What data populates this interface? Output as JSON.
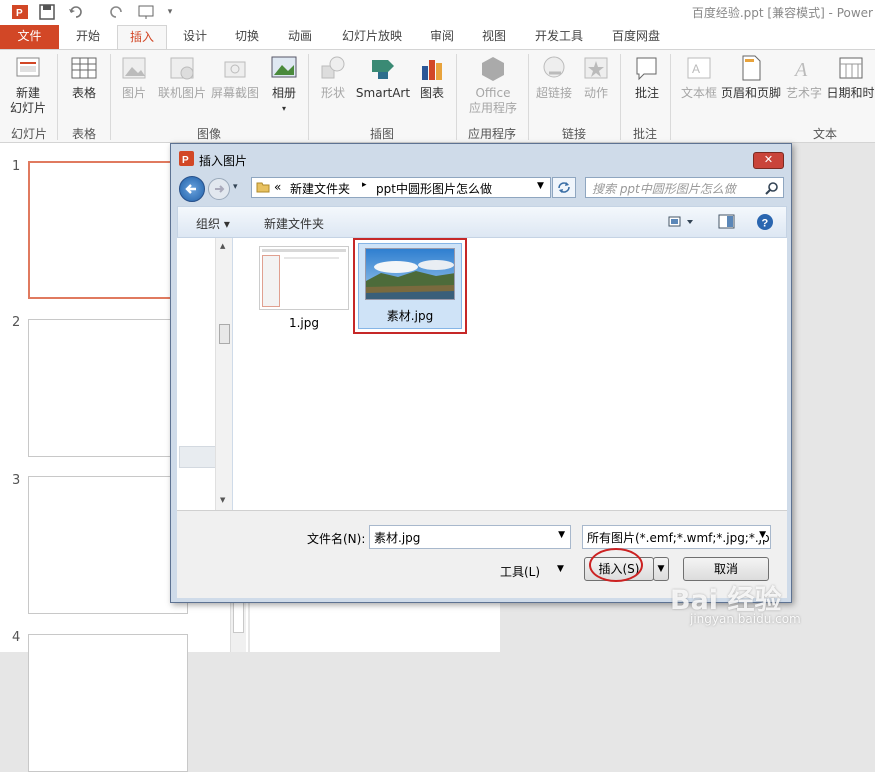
{
  "window": {
    "title": "百度经验.ppt [兼容模式] - Power"
  },
  "tabs": [
    {
      "label": "文件"
    },
    {
      "label": "开始"
    },
    {
      "label": "插入"
    },
    {
      "label": "设计"
    },
    {
      "label": "切换"
    },
    {
      "label": "动画"
    },
    {
      "label": "幻灯片放映"
    },
    {
      "label": "审阅"
    },
    {
      "label": "视图"
    },
    {
      "label": "开发工具"
    },
    {
      "label": "百度网盘"
    }
  ],
  "ribbon": {
    "new_slide": [
      "新建",
      "幻灯片"
    ],
    "table": "表格",
    "picture": "图片",
    "online_picture": "联机图片",
    "screenshot": "屏幕截图",
    "album": "相册",
    "shapes": "形状",
    "smartart": "SmartArt",
    "chart": "图表",
    "office_apps": [
      "Office",
      "应用程序"
    ],
    "hyperlink": "超链接",
    "action": "动作",
    "comment": "批注",
    "textbox": "文本框",
    "header_footer": "页眉和页脚",
    "wordart": "艺术字",
    "datetime": "日期和时",
    "groups": {
      "slides": "幻灯片",
      "tables": "表格",
      "images": "图像",
      "illustrations": "插图",
      "apps": "应用程序",
      "links": "链接",
      "comments": "批注",
      "text": "文本"
    }
  },
  "slides": [
    "1",
    "2",
    "3",
    "4"
  ],
  "dialog": {
    "title": "插入图片",
    "breadcrumb": [
      "«",
      "新建文件夹",
      "ppt中圆形图片怎么做"
    ],
    "search_placeholder": "搜索 ppt中圆形图片怎么做",
    "organize": "组织 ▾",
    "new_folder": "新建文件夹",
    "files": [
      {
        "name": "1.jpg"
      },
      {
        "name": "素材.jpg",
        "selected": true
      }
    ],
    "filename_label": "文件名(N):",
    "filename_value": "素材.jpg",
    "filetype_value": "所有图片(*.emf;*.wmf;*.jpg;*.jp",
    "tools": "工具(L)",
    "insert": "插入(S)",
    "cancel": "取消"
  },
  "watermark": {
    "brand": "Bai 经验",
    "url": "jingyan.baidu.com"
  },
  "colors": {
    "accent": "#d24726",
    "highlight": "#cc2222"
  }
}
